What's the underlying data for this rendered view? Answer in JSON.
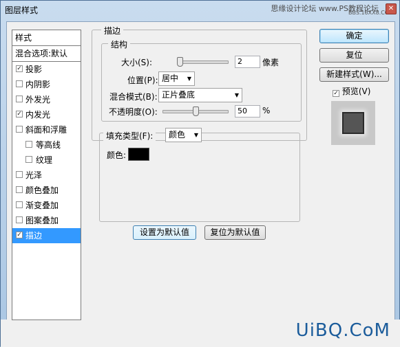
{
  "window": {
    "title": "图层样式",
    "close_glyph": "✕"
  },
  "watermark": {
    "line1": "思缘设计论坛 www.PS教程论坛",
    "line2": "BBS.16XX8.COM"
  },
  "brand": "UiBQ.CoM",
  "left_panel": {
    "header": "样式",
    "blend": "混合选项:默认",
    "items": [
      {
        "label": "投影",
        "checked": true,
        "sub": false
      },
      {
        "label": "内阴影",
        "checked": false,
        "sub": false
      },
      {
        "label": "外发光",
        "checked": false,
        "sub": false
      },
      {
        "label": "内发光",
        "checked": true,
        "sub": false
      },
      {
        "label": "斜面和浮雕",
        "checked": false,
        "sub": false
      },
      {
        "label": "等高线",
        "checked": false,
        "sub": true
      },
      {
        "label": "纹理",
        "checked": false,
        "sub": true
      },
      {
        "label": "光泽",
        "checked": false,
        "sub": false
      },
      {
        "label": "颜色叠加",
        "checked": false,
        "sub": false
      },
      {
        "label": "渐变叠加",
        "checked": false,
        "sub": false
      },
      {
        "label": "图案叠加",
        "checked": false,
        "sub": false
      },
      {
        "label": "描边",
        "checked": true,
        "sub": false,
        "selected": true
      }
    ]
  },
  "stroke": {
    "title": "描边",
    "structure_title": "结构",
    "size_label": "大小(S):",
    "size_value": "2",
    "size_unit": "像素",
    "size_slider": 0.0,
    "position_label": "位置(P):",
    "position_value": "居中",
    "blend_label": "混合模式(B):",
    "blend_value": "正片叠底",
    "opacity_label": "不透明度(O):",
    "opacity_value": "50",
    "opacity_unit": "%",
    "opacity_slider": 0.5,
    "fill_type_label": "填充类型(F):",
    "fill_type_value": "颜色",
    "color_label": "颜色:",
    "color_value": "#000000",
    "set_default": "设置为默认值",
    "reset_default": "复位为默认值"
  },
  "right": {
    "ok": "确定",
    "reset": "复位",
    "new_style": "新建样式(W)...",
    "preview_label": "预览(V)",
    "preview_checked": true
  }
}
